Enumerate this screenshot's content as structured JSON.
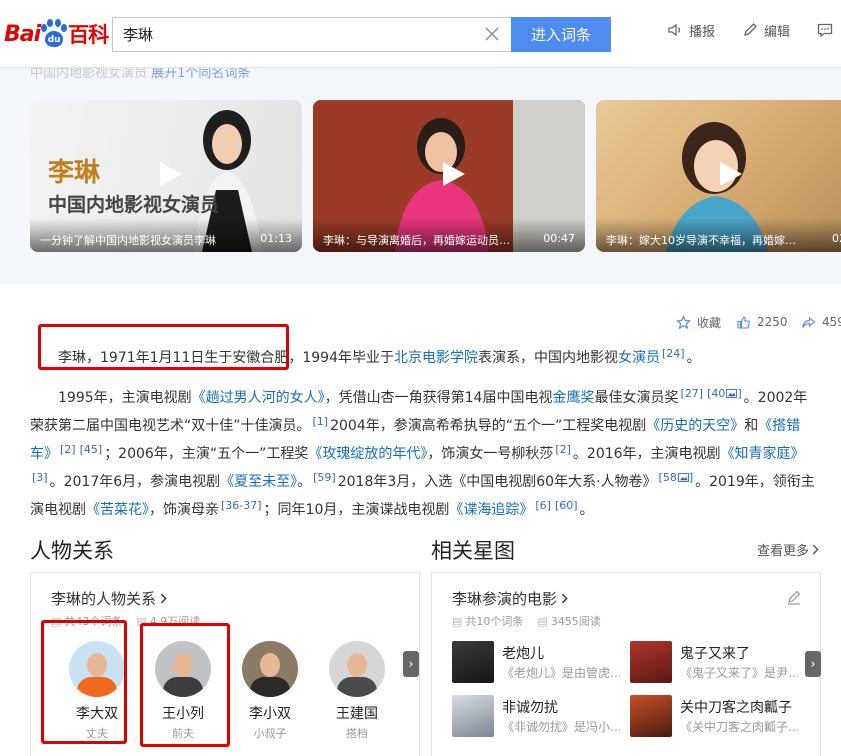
{
  "header": {
    "logo_bai": "Bai",
    "logo_du": "du",
    "logo_baike": "百科",
    "search_value": "李琳",
    "search_button": "进入词条",
    "tools": {
      "broadcast": "播报",
      "edit": "编辑"
    }
  },
  "video_strip": {
    "faded_text": "中国内地影视女演员",
    "faded_link": "展开1个同名词条",
    "videos": [
      {
        "title_big": "李琳",
        "title_sub": "中国内地影视女演员",
        "caption": "一分钟了解中国内地影视女演员李琳",
        "duration": "01:13"
      },
      {
        "caption": "李琳：与导演离婚后，再婚嫁运动员…",
        "duration": "00:47"
      },
      {
        "caption": "李琳：嫁大10岁导演不幸福，再婚嫁…",
        "duration": "02"
      }
    ]
  },
  "stats": {
    "collect": "收藏",
    "likes": "2250",
    "shares": "459"
  },
  "para1": {
    "t1": "李琳，1971年1月11日生于安徽合肥，1994年毕业于",
    "link1": "北京电影学院",
    "t2": "表演系，中国内地影视",
    "link2": "女演员",
    "ref": "[24]",
    "t3": "。"
  },
  "para2": {
    "s1": "1995年，主演电视剧",
    "l1": "《趟过男人河的女人》",
    "s2": "，凭借山杏一角获得第14届中国电视",
    "l2": "金鹰奖",
    "s3": "最佳女演员奖",
    "r1": "[27]",
    "r2": "[40",
    "s4": "。2002年荣获第二届中国电视艺术“双十佳”十佳演员。",
    "r3": "[1]",
    "s5": "2004年，参演高希希执导的“五个一”工程奖电视剧",
    "l3": "《历史的天空》",
    "s6": "和",
    "l4": "《搭错车》",
    "r4": "[2]",
    "r5": "[45]",
    "s7": "；2006年，主演“五个一”工程奖",
    "l5": "《玫瑰绽放的年代》",
    "s8": "，饰演女一号柳秋莎",
    "r6": "[2]",
    "s9": "。2016年，主演电视剧",
    "l6": "《知青家庭》",
    "r7": "[3]",
    "s10": "。2017年6月，参演电视剧",
    "l7": "《夏至未至》",
    "s11": "。",
    "r8": "[59]",
    "s12": "2018年3月，入选《中国电视剧60年大系·人物卷》",
    "r9": "[58",
    "s13": "。2019年，领衔主演电视剧",
    "l8": "《苦菜花》",
    "s14": "，饰演母亲",
    "r10": "[36-37]",
    "s15": "；同年10月，主演谍战电视剧",
    "l9": "《谍海追踪》",
    "r11": "[6]",
    "r12": "[60]",
    "s16": "。"
  },
  "relations": {
    "section_title": "人物关系",
    "panel_title": "李琳的人物关系",
    "meta_entries": "共43个词条",
    "meta_reads": "4.9万阅读",
    "people": [
      {
        "name": "李大双",
        "relation": "丈夫"
      },
      {
        "name": "王小列",
        "relation": "前夫"
      },
      {
        "name": "李小双",
        "relation": "小叔子"
      },
      {
        "name": "王建国",
        "relation": "搭档"
      }
    ],
    "next": "›"
  },
  "stars": {
    "section_title": "相关星图",
    "more": "查看更多",
    "panel_title": "李琳参演的电影",
    "meta_entries": "共10个词条",
    "meta_reads": "3455阅读",
    "movies": [
      {
        "title": "老炮儿",
        "desc": "《老炮儿》是由管虎…"
      },
      {
        "title": "鬼子又来了",
        "desc": "《鬼子又来了》是尹…"
      },
      {
        "title": "非诚勿扰",
        "desc": "《非诚勿扰》是冯小…"
      },
      {
        "title": "关中刀客之肉瓤子",
        "desc": "《关中刀客之肉瓤子…"
      }
    ],
    "next": "›"
  },
  "colors": {
    "link": "#136ec2",
    "accent": "#4e8cf0",
    "highlight_box": "#e00000",
    "logo_red": "#e10601",
    "logo_blue": "#2c6bd9"
  }
}
